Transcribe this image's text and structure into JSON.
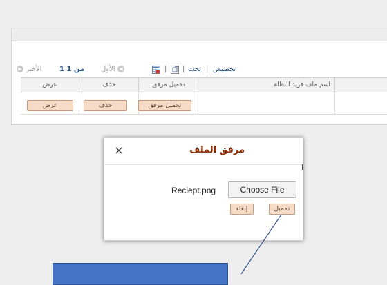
{
  "grid": {
    "customize_link": "تخصيص",
    "find_link": "بحث",
    "first_label": "الأول",
    "page_count": "1 من 1",
    "last_label": "الأخير",
    "columns": [
      "اسم ملف فريد للنظام",
      "تحميل مرفق",
      "حذف",
      "عرض"
    ],
    "row": {
      "upload_button": "تحميل مرفق",
      "delete_button": "حذف",
      "view_button": "عرض"
    }
  },
  "dialog": {
    "title": "مرفق الملف",
    "close_symbol": "×",
    "file_name": "Reciept.png",
    "choose_file_button": "Choose File",
    "upload_button": "تحميل",
    "cancel_button": "إلغاء"
  },
  "colors": {
    "button_bg": "#f6dcc7",
    "button_border": "#c99a7a",
    "dialog_title": "#8a2a00",
    "link": "#1f4f86",
    "callout": "#4472c4"
  }
}
